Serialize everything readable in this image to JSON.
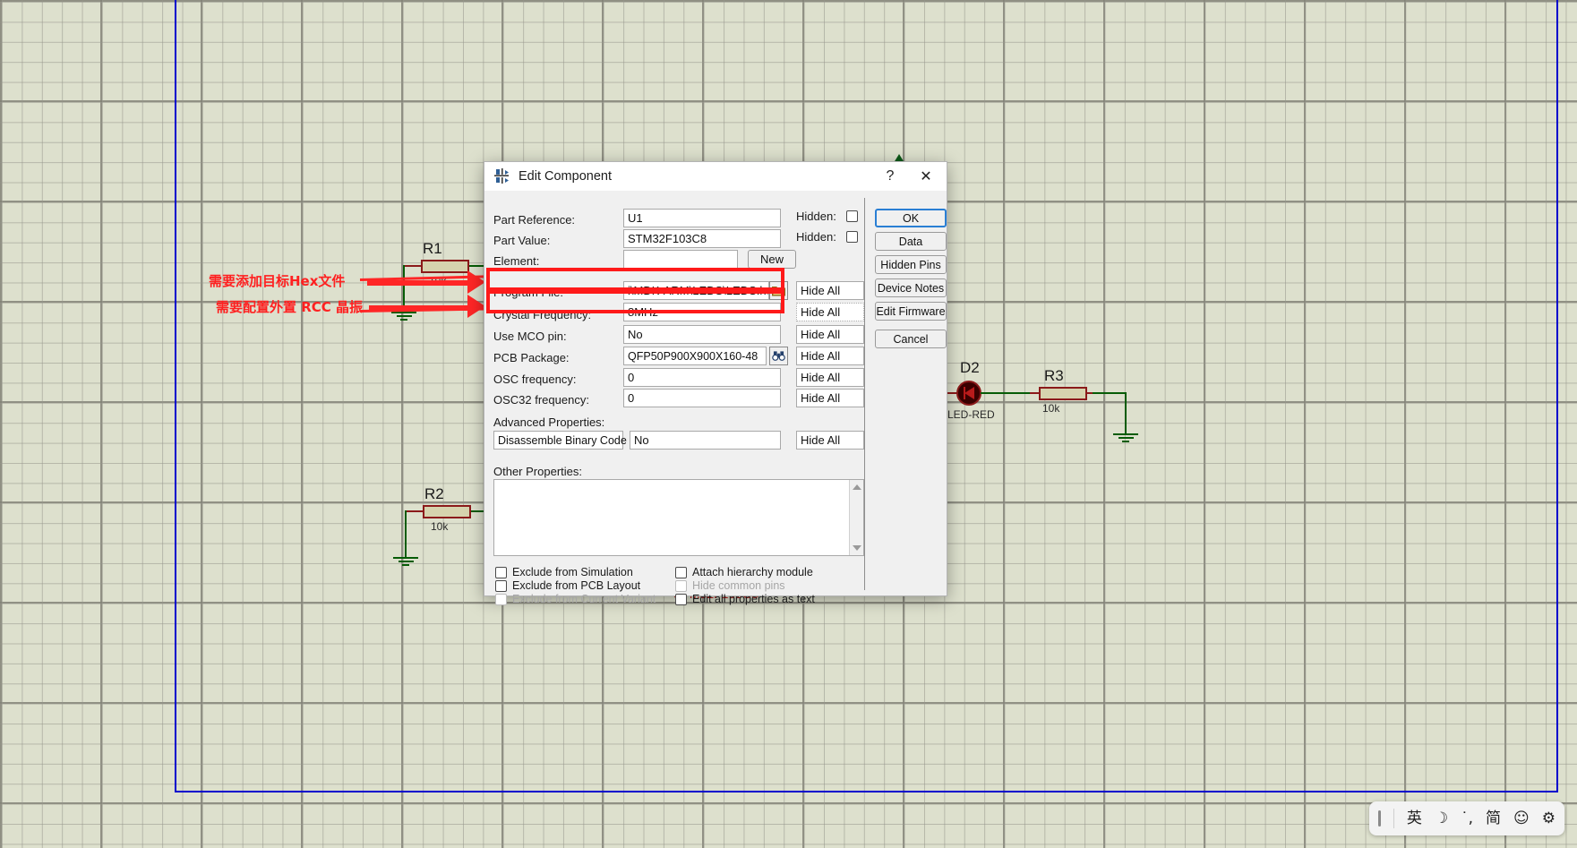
{
  "app": {
    "canvas_background": "#dde0cd",
    "sheet_border_color": "#0000cc"
  },
  "schematic": {
    "components": [
      {
        "ref": "R1",
        "value": "10k",
        "type": "resistor"
      },
      {
        "ref": "R2",
        "value": "10k",
        "type": "resistor"
      },
      {
        "ref": "R3",
        "value": "10k",
        "type": "resistor"
      },
      {
        "ref": "D2",
        "value": "LED-RED",
        "type": "led"
      }
    ],
    "obscured_part_value": "STM32F103C8"
  },
  "annotations": [
    {
      "text": "需要添加目标Hex文件",
      "color": "#ff2020",
      "points_to": "Program File"
    },
    {
      "text": "需要配置外置 RCC 晶振",
      "color": "#ff2020",
      "points_to": "Crystal Frequency"
    }
  ],
  "dialog": {
    "title": "Edit Component",
    "title_icon": "component-icon",
    "help_button": "?",
    "close_button": "✕",
    "fields": {
      "part_reference": {
        "label": "Part Reference:",
        "underline": "R",
        "value": "U1",
        "hidden_label": "Hidden:",
        "hidden_checked": false
      },
      "part_value": {
        "label": "Part Value:",
        "underline": "V",
        "value": "STM32F103C8",
        "hidden_label": "Hidden:",
        "hidden_checked": false
      },
      "element": {
        "label": "Element:",
        "underline": "E",
        "value": "",
        "new_button": "New"
      },
      "program_file": {
        "label": "Program File:",
        "value": "i\\MDK-ARM\\LEDS\\LEDS.hex",
        "browse_icon": "folder-icon",
        "hide_option": "Hide All",
        "highlighted": true
      },
      "crystal_frequency": {
        "label": "Crystal Frequency:",
        "value": "8MHz",
        "hide_option": "Hide All",
        "highlighted": true
      },
      "use_mco_pin": {
        "label": "Use MCO pin:",
        "value": "No",
        "hide_option": "Hide All"
      },
      "pcb_package": {
        "label": "PCB Package:",
        "value": "QFP50P900X900X160-48",
        "browse_icon": "binoculars-icon",
        "hide_option": "Hide All"
      },
      "osc_frequency": {
        "label": "OSC frequency:",
        "value": "0",
        "hide_option": "Hide All"
      },
      "osc32_frequency": {
        "label": "OSC32 frequency:",
        "value": "0",
        "hide_option": "Hide All"
      }
    },
    "advanced_properties": {
      "label": "Advanced Properties:",
      "property": "Disassemble Binary Code",
      "value": "No",
      "hide_option": "Hide All"
    },
    "other_properties": {
      "label": "Other Properties:",
      "underline": "P",
      "value": ""
    },
    "checkboxes_left": [
      {
        "label": "Exclude from Simulation",
        "checked": false,
        "disabled": false
      },
      {
        "label": "Exclude from PCB Layout",
        "checked": false,
        "disabled": false
      },
      {
        "label": "Exclude from Current Variant",
        "checked": false,
        "disabled": true
      }
    ],
    "checkboxes_right": [
      {
        "label": "Attach hierarchy module",
        "checked": false,
        "disabled": false
      },
      {
        "label": "Hide common pins",
        "checked": false,
        "disabled": true
      },
      {
        "label": "Edit all properties as text",
        "checked": false,
        "disabled": false
      }
    ],
    "buttons": [
      {
        "label": "OK",
        "primary": true
      },
      {
        "label": "Data",
        "primary": false
      },
      {
        "label": "Hidden Pins",
        "primary": false
      },
      {
        "label": "Device Notes",
        "primary": false
      },
      {
        "label": "Edit Firmware",
        "primary": false
      },
      {
        "label": "Cancel",
        "primary": false
      }
    ]
  },
  "ime_bar": {
    "items": [
      {
        "name": "caret-indicator",
        "glyph": ""
      },
      {
        "name": "language-english",
        "glyph": "英"
      },
      {
        "name": "moon-mode",
        "glyph": "☽"
      },
      {
        "name": "punctuation-mode",
        "glyph": "˙,"
      },
      {
        "name": "simplified-chinese",
        "glyph": "简"
      },
      {
        "name": "emoji",
        "glyph": "☺"
      },
      {
        "name": "settings",
        "glyph": "⚙"
      }
    ]
  }
}
